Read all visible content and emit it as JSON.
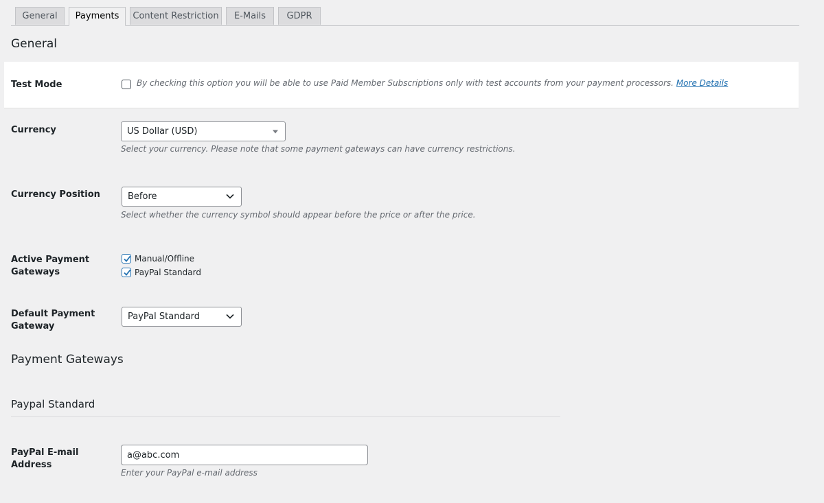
{
  "tabs": [
    {
      "label": "General",
      "active": false
    },
    {
      "label": "Payments",
      "active": true
    },
    {
      "label": "Content Restriction",
      "active": false
    },
    {
      "label": "E-Mails",
      "active": false
    },
    {
      "label": "GDPR",
      "active": false
    }
  ],
  "general": {
    "heading": "General",
    "test_mode": {
      "label": "Test Mode",
      "checked": false,
      "description": "By checking this option you will be able to use Paid Member Subscriptions only with test accounts from your payment processors.",
      "link_text": "More Details"
    },
    "currency": {
      "label": "Currency",
      "value": "US Dollar (USD)",
      "description": "Select your currency. Please note that some payment gateways can have currency restrictions."
    },
    "currency_position": {
      "label": "Currency Position",
      "value": "Before",
      "description": "Select whether the currency symbol should appear before the price or after the price."
    },
    "active_gateways": {
      "label": "Active Payment Gateways",
      "options": [
        {
          "label": "Manual/Offline",
          "checked": true
        },
        {
          "label": "PayPal Standard",
          "checked": true
        }
      ]
    },
    "default_gateway": {
      "label": "Default Payment Gateway",
      "value": "PayPal Standard"
    }
  },
  "payment_gateways": {
    "heading": "Payment Gateways",
    "paypal_standard": {
      "heading": "Paypal Standard",
      "email": {
        "label": "PayPal E-mail Address",
        "value": "a@abc.com",
        "description": "Enter your PayPal e-mail address"
      }
    }
  },
  "colors": {
    "background": "#f0f0f1",
    "accent": "#2271b1",
    "tab_inactive": "#dcdcde"
  }
}
